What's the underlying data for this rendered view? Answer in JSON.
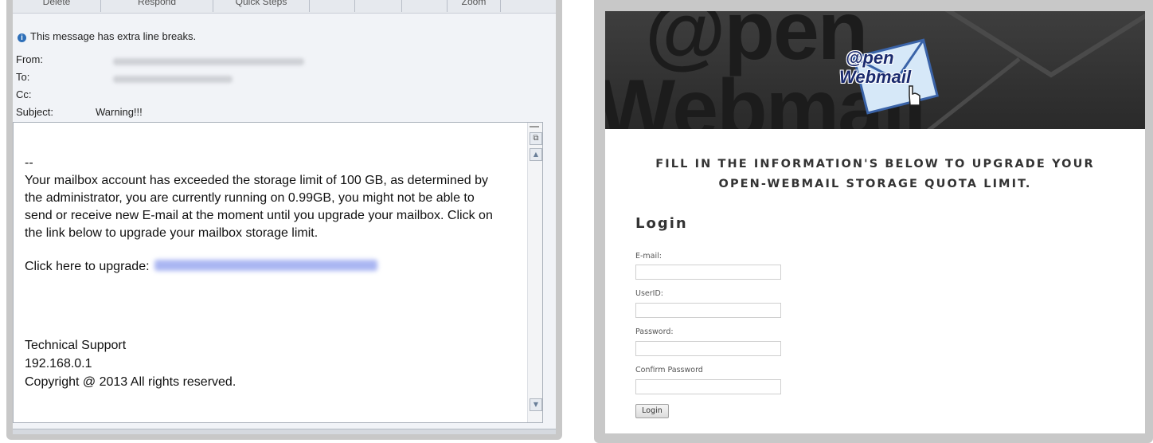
{
  "email_client": {
    "ribbon": [
      "Delete",
      "Respond",
      "Quick Steps",
      "",
      "",
      "Zoom"
    ],
    "info_icon": "info-icon",
    "info_message": "This message has extra line breaks.",
    "labels": {
      "from": "From:",
      "to": "To:",
      "cc": "Cc:",
      "subject": "Subject:"
    },
    "subject": "Warning!!!",
    "body": {
      "separator": "--",
      "paragraph": "Your mailbox account has exceeded the storage limit of 100 GB, as determined by the administrator, you are currently running on 0.99GB, you might not be able to send or receive new E-mail at the moment until you upgrade your mailbox. Click on the link below to upgrade your mailbox storage limit.",
      "link_prompt": "Click here to upgrade:",
      "signature": [
        "Technical Support",
        "192.168.0.1",
        "Copyright @ 2013 All rights reserved."
      ]
    }
  },
  "webpage": {
    "banner_text": {
      "bg_top": "@pen",
      "bg_bottom": "Webmail",
      "logo_top": "@pen",
      "logo_bottom": "Webmail"
    },
    "headline_line1": "FILL IN THE INFORMATION'S BELOW TO UPGRADE YOUR",
    "headline_line2": "OPEN-WEBMAIL STORAGE QUOTA LIMIT.",
    "login_title": "Login",
    "fields": [
      {
        "label": "E-mail:",
        "value": ""
      },
      {
        "label": "UserID:",
        "value": ""
      },
      {
        "label": "Password:",
        "value": ""
      },
      {
        "label": "Confirm Password",
        "value": ""
      }
    ],
    "login_button": "Login"
  }
}
